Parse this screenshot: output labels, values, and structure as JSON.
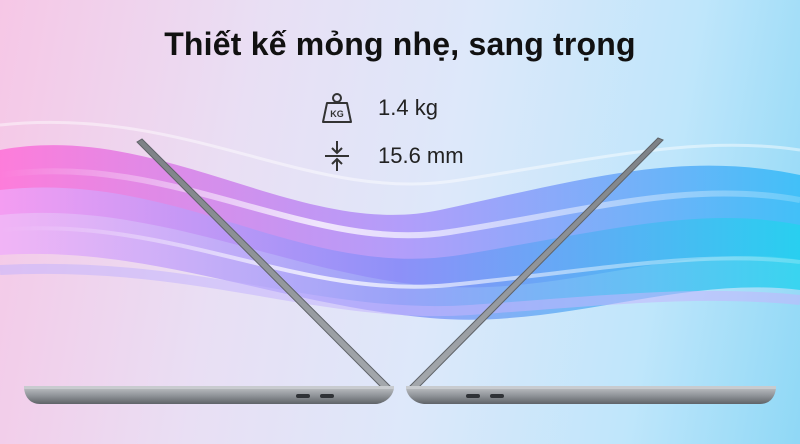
{
  "title": "Thiết kế mỏng nhẹ, sang trọng",
  "specs": {
    "weight": {
      "icon": "weight-kg-icon",
      "icon_text": "KG",
      "value": "1.4 kg"
    },
    "thickness": {
      "icon": "thickness-compress-icon",
      "value": "15.6 mm"
    }
  },
  "colors": {
    "laptop_body": "#8e9297",
    "laptop_edge": "#5f6368",
    "wave_pink": "#e86fd4",
    "wave_violet": "#9a8cf0",
    "wave_blue": "#4bb9f2"
  }
}
